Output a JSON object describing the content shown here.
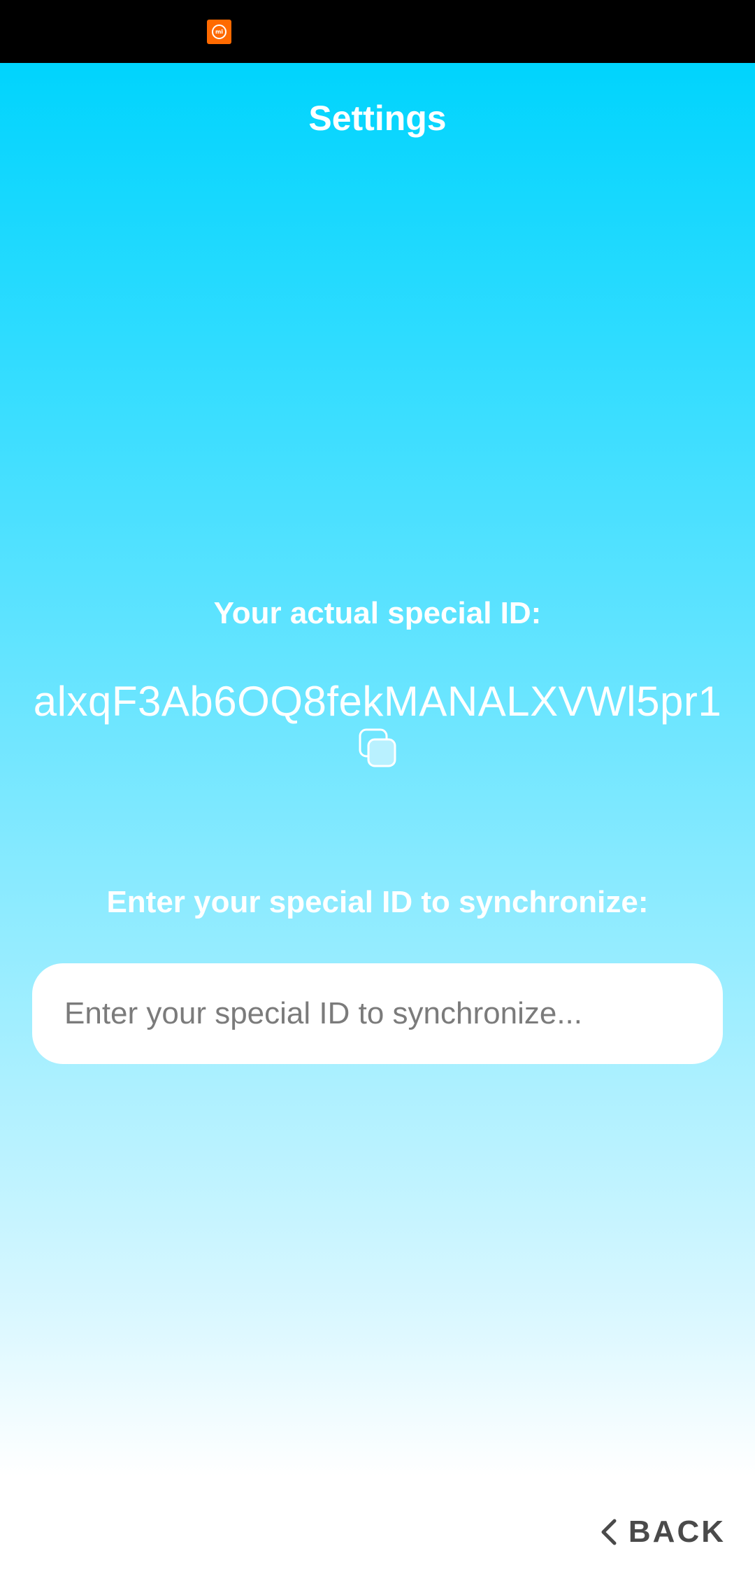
{
  "status_bar": {
    "notification_icon": "mi-app-icon",
    "notification_icon_text": "mi"
  },
  "header": {
    "title": "Settings"
  },
  "special_id": {
    "label": "Your actual special ID:",
    "value": "alxqF3Ab6OQ8fekMANALXVWl5pr1",
    "copy_icon": "copy-icon"
  },
  "sync": {
    "label": "Enter your special ID to synchronize:",
    "input_value": "",
    "placeholder": "Enter your special ID to synchronize..."
  },
  "footer": {
    "back_label": "BACK",
    "back_icon": "chevron-left-icon"
  },
  "colors": {
    "gradient_top": "#00d4fd",
    "gradient_bottom": "#ffffff",
    "status_bar": "#000000",
    "mi_orange": "#ff6a00",
    "back_text": "#4a4a4a"
  }
}
